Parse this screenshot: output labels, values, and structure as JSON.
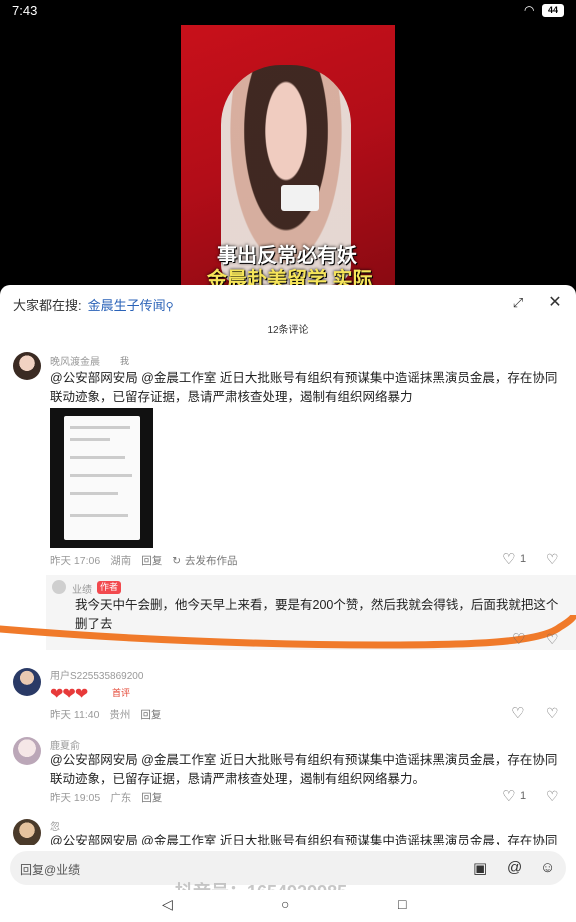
{
  "status_bar": {
    "time": "7:43",
    "battery": "44"
  },
  "video": {
    "caption_line1": "事出反常必有妖",
    "caption_line2": "金晨赴美留学 实际"
  },
  "search": {
    "prefix": "大家都在搜:",
    "keyword": "金晨生子传闻"
  },
  "comments_count": "12条评论",
  "comments": [
    {
      "username": "晚风渡金晨",
      "badge": "我",
      "text": "@公安部网安局 @金晨工作室 近日大批账号有组织有预谋集中造谣抹黑演员金晨，存在协同联动迹象，已留存证据，恳请严肃核查处理，遏制有组织网络暴力",
      "time": "昨天 17:06",
      "location": "湖南",
      "reply": "回复",
      "share": "去发布作品",
      "likes": "1"
    },
    {
      "username": "业绩",
      "badge": "作者",
      "text": "我今天中午会删，他今天早上来看，要是有200个赞，然后我就会得钱，后面我就把这个删了去"
    },
    {
      "username": "用户S225535869200",
      "emoji": "❤❤❤",
      "tag": "首评",
      "time": "昨天 11:40",
      "location": "贵州",
      "reply": "回复"
    },
    {
      "username": "鹿夏俞",
      "text": "@公安部网安局 @金晨工作室 近日大批账号有组织有预谋集中造谣抹黑演员金晨，存在协同联动迹象，已留存证据，恳请严肃核查处理，遏制有组织网络暴力。",
      "time": "昨天 19:05",
      "location": "广东",
      "reply": "回复",
      "likes": "1"
    },
    {
      "username": "忽",
      "text": "@公安部网安局 @金晨工作室 近日大批账号有组织有预谋集中造谣抹黑演员金晨，存在协同"
    }
  ],
  "input": {
    "placeholder": "回复@业绩"
  },
  "watermark": "抖音号：1654929985",
  "colors": {
    "accent_link": "#2b63b8",
    "author_badge": "#f2494e",
    "orange_stroke": "#f07a2a",
    "video_bg": "#c8101a"
  }
}
